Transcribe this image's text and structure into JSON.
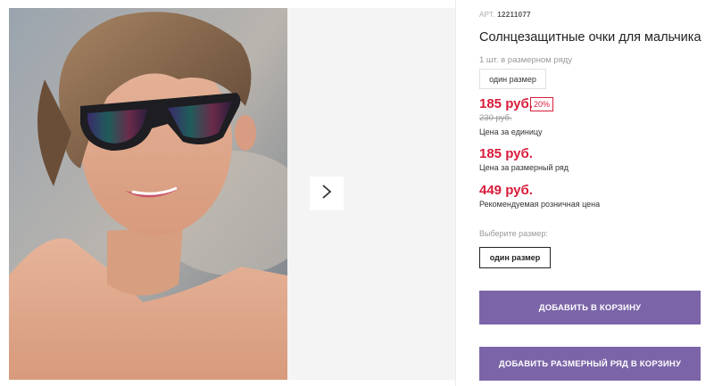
{
  "product": {
    "art_label": "АРТ.",
    "art_number": "12211077",
    "title": "Солнцезащитные очки для мальчика",
    "pack_note": "1 шт. в размерном ряду",
    "pack_size_chip": "один размер"
  },
  "prices": {
    "unit_price": "185 руб.",
    "discount_badge": "20%",
    "old_price": "230 руб.",
    "unit_label": "Цена за единицу",
    "range_price": "185 руб.",
    "range_label": "Цена за размерный ряд",
    "retail_price": "449 руб.",
    "retail_label": "Рекомендуемая розничная цена"
  },
  "size_select": {
    "label": "Выберите размер:",
    "option": "один размер"
  },
  "actions": {
    "add_to_cart": "ДОБАВИТЬ В КОРЗИНУ",
    "add_range_to_cart": "ДОБАВИТЬ РАЗМЕРНЫЙ РЯД В КОРЗИНУ"
  },
  "gallery": {
    "next_icon": "chevron-right-icon"
  },
  "colors": {
    "accent": "#7b65a8",
    "price": "#d81b3a"
  }
}
